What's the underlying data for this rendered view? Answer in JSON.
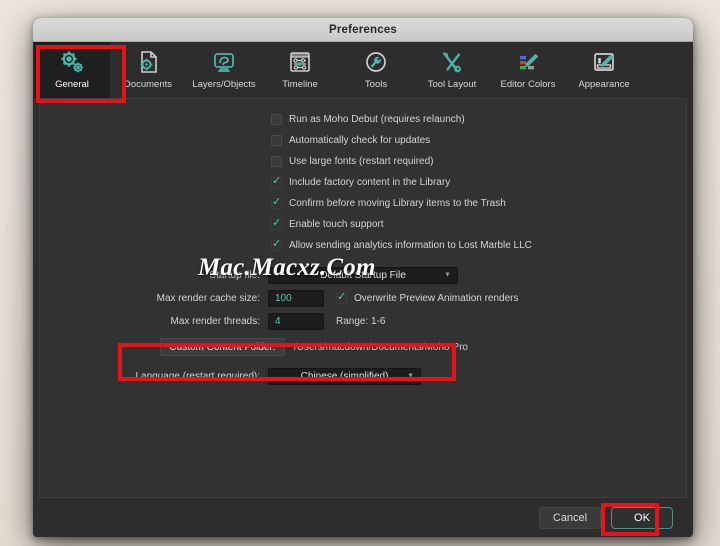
{
  "window": {
    "title": "Preferences"
  },
  "tabs": [
    {
      "label": "General",
      "icon": "gears-icon",
      "selected": true
    },
    {
      "label": "Documents",
      "icon": "document-gear-icon",
      "selected": false
    },
    {
      "label": "Layers/Objects",
      "icon": "monitor-shape-icon",
      "selected": false
    },
    {
      "label": "Timeline",
      "icon": "timeline-icon",
      "selected": false
    },
    {
      "label": "Tools",
      "icon": "wrench-circle-icon",
      "selected": false
    },
    {
      "label": "Tool Layout",
      "icon": "wrench-screwdriver-icon",
      "selected": false
    },
    {
      "label": "Editor Colors",
      "icon": "color-swatches-pen-icon",
      "selected": false
    },
    {
      "label": "Appearance",
      "icon": "tablet-pen-icon",
      "selected": false
    }
  ],
  "checkboxes": [
    {
      "label": "Run as Moho Debut (requires relaunch)",
      "checked": false
    },
    {
      "label": "Automatically check for updates",
      "checked": false
    },
    {
      "label": "Use large fonts (restart required)",
      "checked": false
    },
    {
      "label": "Include factory content in the Library",
      "checked": true
    },
    {
      "label": "Confirm before moving Library items to the Trash",
      "checked": true
    },
    {
      "label": "Enable touch support",
      "checked": true
    },
    {
      "label": "Allow sending analytics information to Lost Marble LLC",
      "checked": true
    }
  ],
  "fields": {
    "startup_file": {
      "label": "Startup file:",
      "value": "Default Startup File"
    },
    "max_render_cache": {
      "label": "Max render cache size:",
      "value": "100",
      "overwrite_label": "Overwrite Preview Animation renders",
      "overwrite_checked": true
    },
    "max_render_threads": {
      "label": "Max render threads:",
      "value": "4",
      "range_label": "Range: 1-6"
    },
    "custom_content_folder": {
      "button_label": "Custom Content Folder:",
      "path": "/Users/macdown/Documents/Moho Pro"
    },
    "language": {
      "label": "Language (restart required):",
      "value": "Chinese (simplified)"
    }
  },
  "watermark": {
    "text": "Mac.Macxz.Com"
  },
  "buttons": {
    "cancel": "Cancel",
    "ok": "OK"
  },
  "colors": {
    "accent_teal": "#4fb3a6",
    "annotation_red": "#e8131a",
    "panel_bg": "#323232",
    "window_bg": "#2d2d2d",
    "field_text": "#5fc3b6"
  }
}
